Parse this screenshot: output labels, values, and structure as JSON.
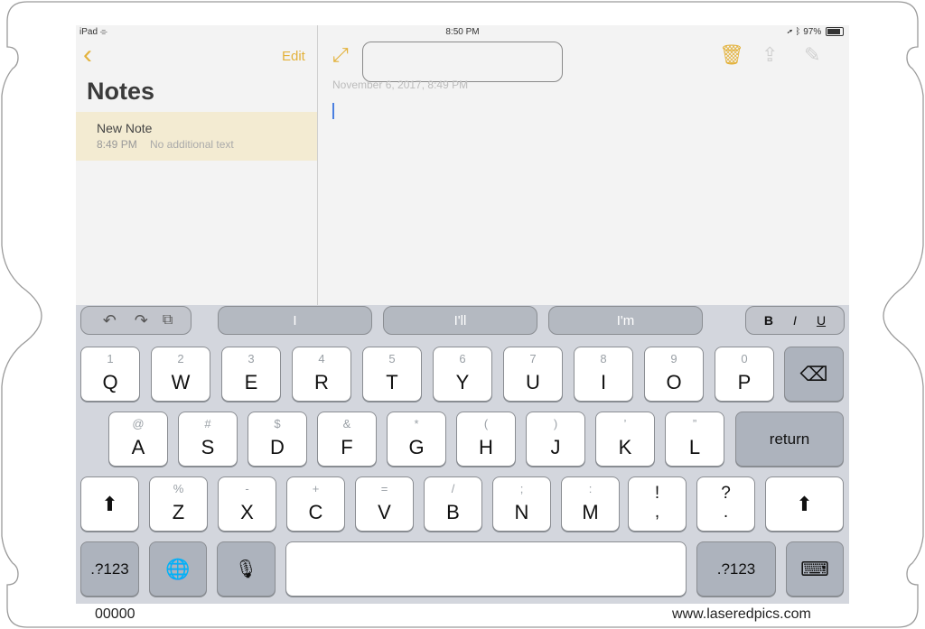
{
  "status": {
    "device": "iPad",
    "time": "8:50 PM",
    "battery": "97%"
  },
  "sidebar": {
    "edit_label": "Edit",
    "title": "Notes",
    "note": {
      "name": "New Note",
      "time": "8:49 PM",
      "preview": "No additional text"
    }
  },
  "editor": {
    "date": "November 6, 2017, 8:49 PM"
  },
  "suggestions": [
    "I",
    "I'll",
    "I'm"
  ],
  "format": {
    "bold": "B",
    "italic": "I",
    "underline": "U"
  },
  "keys": {
    "row1": [
      [
        "1",
        "Q"
      ],
      [
        "2",
        "W"
      ],
      [
        "3",
        "E"
      ],
      [
        "4",
        "R"
      ],
      [
        "5",
        "T"
      ],
      [
        "6",
        "Y"
      ],
      [
        "7",
        "U"
      ],
      [
        "8",
        "I"
      ],
      [
        "9",
        "O"
      ],
      [
        "0",
        "P"
      ]
    ],
    "row2": [
      [
        "@",
        "A"
      ],
      [
        "#",
        "S"
      ],
      [
        "$",
        "D"
      ],
      [
        "&",
        "F"
      ],
      [
        "*",
        "G"
      ],
      [
        "(",
        "H"
      ],
      [
        ")",
        "J"
      ],
      [
        "’",
        "K"
      ],
      [
        "”",
        "L"
      ]
    ],
    "row3": [
      [
        "%",
        "Z"
      ],
      [
        "-",
        "X"
      ],
      [
        "+",
        "C"
      ],
      [
        "=",
        "V"
      ],
      [
        "/",
        "B"
      ],
      [
        ";",
        "N"
      ],
      [
        ":",
        "M"
      ]
    ],
    "exclaim": [
      "!",
      ","
    ],
    "question": [
      "?",
      "."
    ],
    "return_label": "return",
    "numbers_label": ".?123"
  },
  "footer": {
    "left": "00000",
    "right": "www.laseredpics.com"
  }
}
